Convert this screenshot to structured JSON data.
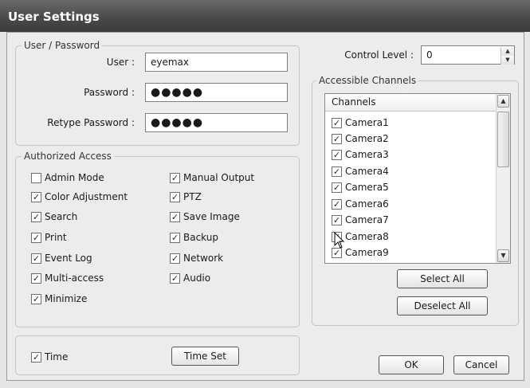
{
  "window": {
    "title": "User Settings"
  },
  "user_password": {
    "legend": "User / Password",
    "user_label": "User :",
    "user_value": "eyemax",
    "password_label": "Password :",
    "password_value": "●●●●●",
    "retype_label": "Retype Password :",
    "retype_value": "●●●●●"
  },
  "control_level": {
    "label": "Control Level :",
    "value": "0"
  },
  "authorized_access": {
    "legend": "Authorized Access",
    "left": [
      {
        "label": "Admin Mode",
        "checked": false
      },
      {
        "label": "Color Adjustment",
        "checked": true
      },
      {
        "label": "Search",
        "checked": true
      },
      {
        "label": "Print",
        "checked": true
      },
      {
        "label": "Event Log",
        "checked": true
      },
      {
        "label": "Multi-access",
        "checked": true
      },
      {
        "label": "Minimize",
        "checked": true
      }
    ],
    "right": [
      {
        "label": "Manual Output",
        "checked": true
      },
      {
        "label": "PTZ",
        "checked": true
      },
      {
        "label": "Save Image",
        "checked": true
      },
      {
        "label": "Backup",
        "checked": true
      },
      {
        "label": "Network",
        "checked": true
      },
      {
        "label": "Audio",
        "checked": true
      }
    ]
  },
  "channels": {
    "legend": "Accessible Channels",
    "header": "Channels",
    "items": [
      {
        "label": "Camera1",
        "checked": true
      },
      {
        "label": "Camera2",
        "checked": true
      },
      {
        "label": "Camera3",
        "checked": true
      },
      {
        "label": "Camera4",
        "checked": true
      },
      {
        "label": "Camera5",
        "checked": true
      },
      {
        "label": "Camera6",
        "checked": true
      },
      {
        "label": "Camera7",
        "checked": true
      },
      {
        "label": "Camera8",
        "checked": true
      },
      {
        "label": "Camera9",
        "checked": true
      }
    ],
    "select_all": "Select All",
    "deselect_all": "Deselect All"
  },
  "time": {
    "label": "Time",
    "checked": true,
    "button": "Time Set"
  },
  "buttons": {
    "ok": "OK",
    "cancel": "Cancel"
  },
  "icons": {
    "check": "✓",
    "spin_up": "▲",
    "spin_down": "▼",
    "scroll_up": "▲",
    "scroll_down": "▼"
  }
}
